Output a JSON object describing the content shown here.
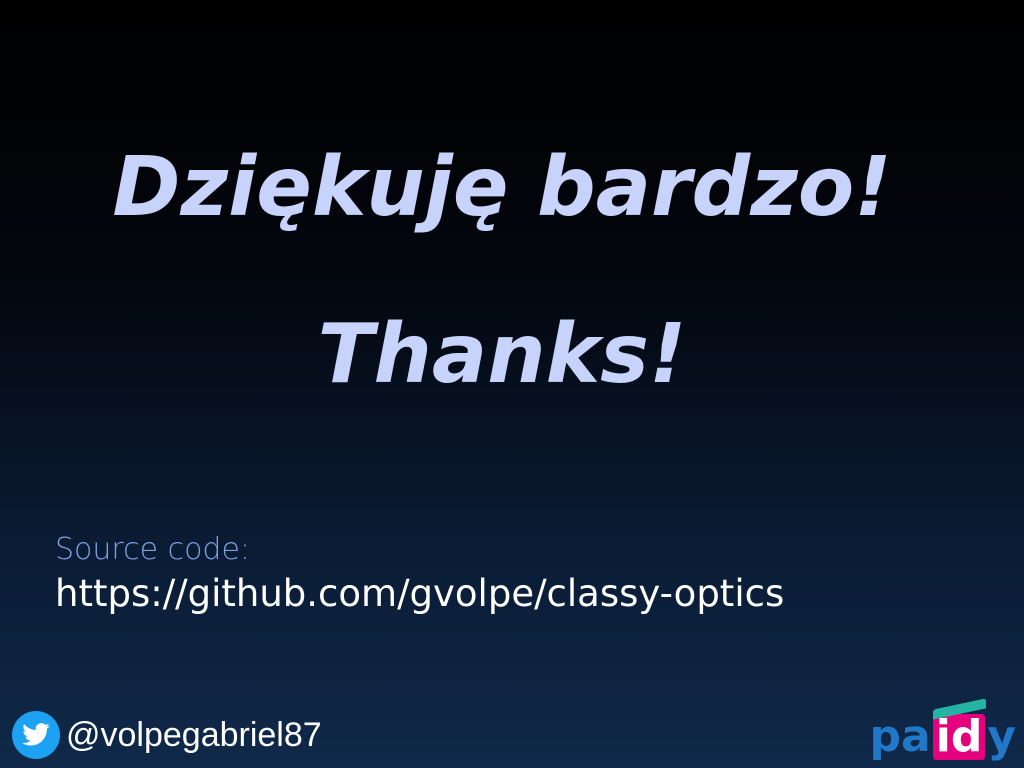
{
  "slide": {
    "title_pl": "Dziękuję bardzo!",
    "title_en": "Thanks!"
  },
  "source": {
    "label": "Source code:",
    "url": "https://github.com/gvolpe/classy-optics"
  },
  "twitter": {
    "handle": "@volpegabriel87",
    "icon": "twitter-bird-icon",
    "color": "#1da1f2"
  },
  "logo": {
    "brand": "paidy",
    "part_pa": "pa",
    "part_id": "id",
    "part_y": "y",
    "colors": {
      "blue": "#2177c8",
      "pink": "#e5007e",
      "teal": "#25b4a4"
    }
  },
  "theme": {
    "title_color": "#c7d3fb",
    "label_color": "#7fa1e0",
    "text_color": "#ffffff"
  }
}
